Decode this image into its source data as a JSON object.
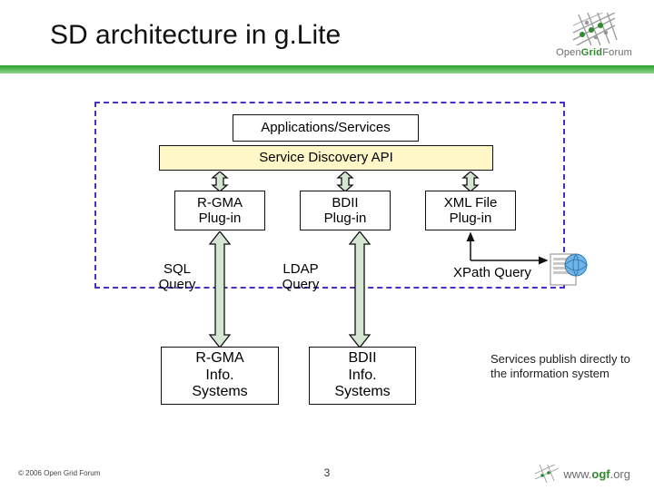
{
  "title": "SD architecture in g.Lite",
  "boxes": {
    "apps": "Applications/Services",
    "api": "Service Discovery API",
    "rgma_plugin": "R-GMA\nPlug-in",
    "bdii_plugin": "BDII\nPlug-in",
    "xml_plugin": "XML File\nPlug-in",
    "rgma_info": "R-GMA\nInfo.\nSystems",
    "bdii_info": "BDII\nInfo.\nSystems"
  },
  "labels": {
    "sql": "SQL\nQuery",
    "ldap": "LDAP\nQuery",
    "xpath": "XPath Query"
  },
  "caption": "Services publish directly to the information system",
  "footer": {
    "copyright": "© 2006 Open Grid Forum",
    "page": "3",
    "url_prefix": "www.",
    "url_bold": "ogf",
    "url_suffix": ".org"
  },
  "logo": {
    "line1_a": "Open",
    "line1_b": "Grid",
    "line1_c": "Forum"
  },
  "colors": {
    "green": "#2aa02a",
    "purple_dash": "#4a2fc7",
    "arrow_light": "#d5e6d3",
    "api_bg": "#fff7c7"
  }
}
